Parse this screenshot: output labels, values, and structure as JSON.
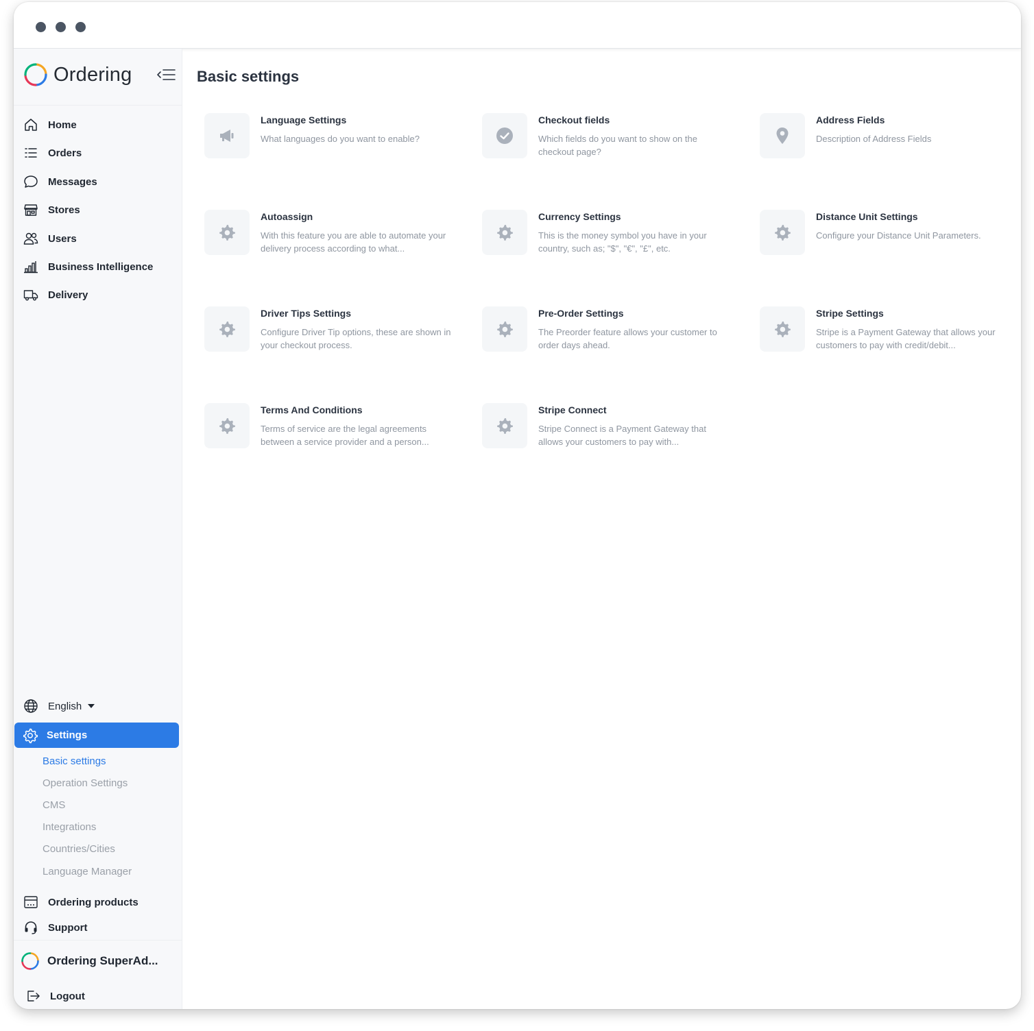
{
  "window": {
    "controls": [
      "close",
      "minimize",
      "maximize"
    ]
  },
  "sidebar": {
    "brand": "Ordering",
    "nav": [
      {
        "label": "Home",
        "icon": "home-icon"
      },
      {
        "label": "Orders",
        "icon": "list-icon"
      },
      {
        "label": "Messages",
        "icon": "chat-icon"
      },
      {
        "label": "Stores",
        "icon": "store-icon"
      },
      {
        "label": "Users",
        "icon": "users-icon"
      },
      {
        "label": "Business Intelligence",
        "icon": "bar-chart-icon"
      },
      {
        "label": "Delivery",
        "icon": "truck-icon"
      }
    ],
    "language": "English",
    "settings_label": "Settings",
    "settings_sub": [
      {
        "label": "Basic settings",
        "selected": true
      },
      {
        "label": "Operation Settings",
        "selected": false
      },
      {
        "label": "CMS",
        "selected": false
      },
      {
        "label": "Integrations",
        "selected": false
      },
      {
        "label": "Countries/Cities",
        "selected": false
      },
      {
        "label": "Language Manager",
        "selected": false
      }
    ],
    "ordering_products": "Ordering products",
    "support": "Support",
    "user_name": "Ordering SuperAd...",
    "logout": "Logout"
  },
  "main": {
    "title": "Basic settings",
    "cards": [
      {
        "title": "Language Settings",
        "desc": "What languages do you want to enable?",
        "icon": "megaphone-icon"
      },
      {
        "title": "Checkout fields",
        "desc": "Which fields do you want to show on the checkout page?",
        "icon": "check-circle-icon"
      },
      {
        "title": "Address Fields",
        "desc": "Description of Address Fields",
        "icon": "map-pin-icon"
      },
      {
        "title": "Autoassign",
        "desc": "With this feature you are able to automate your delivery process according to what...",
        "icon": "gear-icon"
      },
      {
        "title": "Currency Settings",
        "desc": "This is the money symbol you have in your country, such as; \"$\", \"€\", \"£\", etc.",
        "icon": "gear-icon"
      },
      {
        "title": "Distance Unit Settings",
        "desc": "Configure your Distance Unit Parameters.",
        "icon": "gear-icon"
      },
      {
        "title": "Driver Tips Settings",
        "desc": "Configure Driver Tip options, these are shown in your checkout process.",
        "icon": "gear-icon"
      },
      {
        "title": "Pre-Order Settings",
        "desc": "The Preorder feature allows your customer to order days ahead.",
        "icon": "gear-icon"
      },
      {
        "title": "Stripe Settings",
        "desc": "Stripe is a Payment Gateway that allows your customers to pay with credit/debit...",
        "icon": "gear-icon"
      },
      {
        "title": "Terms And Conditions",
        "desc": "Terms of service are the legal agreements between a service provider and a person...",
        "icon": "gear-icon"
      },
      {
        "title": "Stripe Connect",
        "desc": "Stripe Connect is a Payment Gateway that allows your customers to pay with...",
        "icon": "gear-icon"
      }
    ]
  },
  "colors": {
    "accent": "#2c7be5",
    "sidebar_bg": "#f7f8fa",
    "icon_gray": "#aab1bb"
  }
}
